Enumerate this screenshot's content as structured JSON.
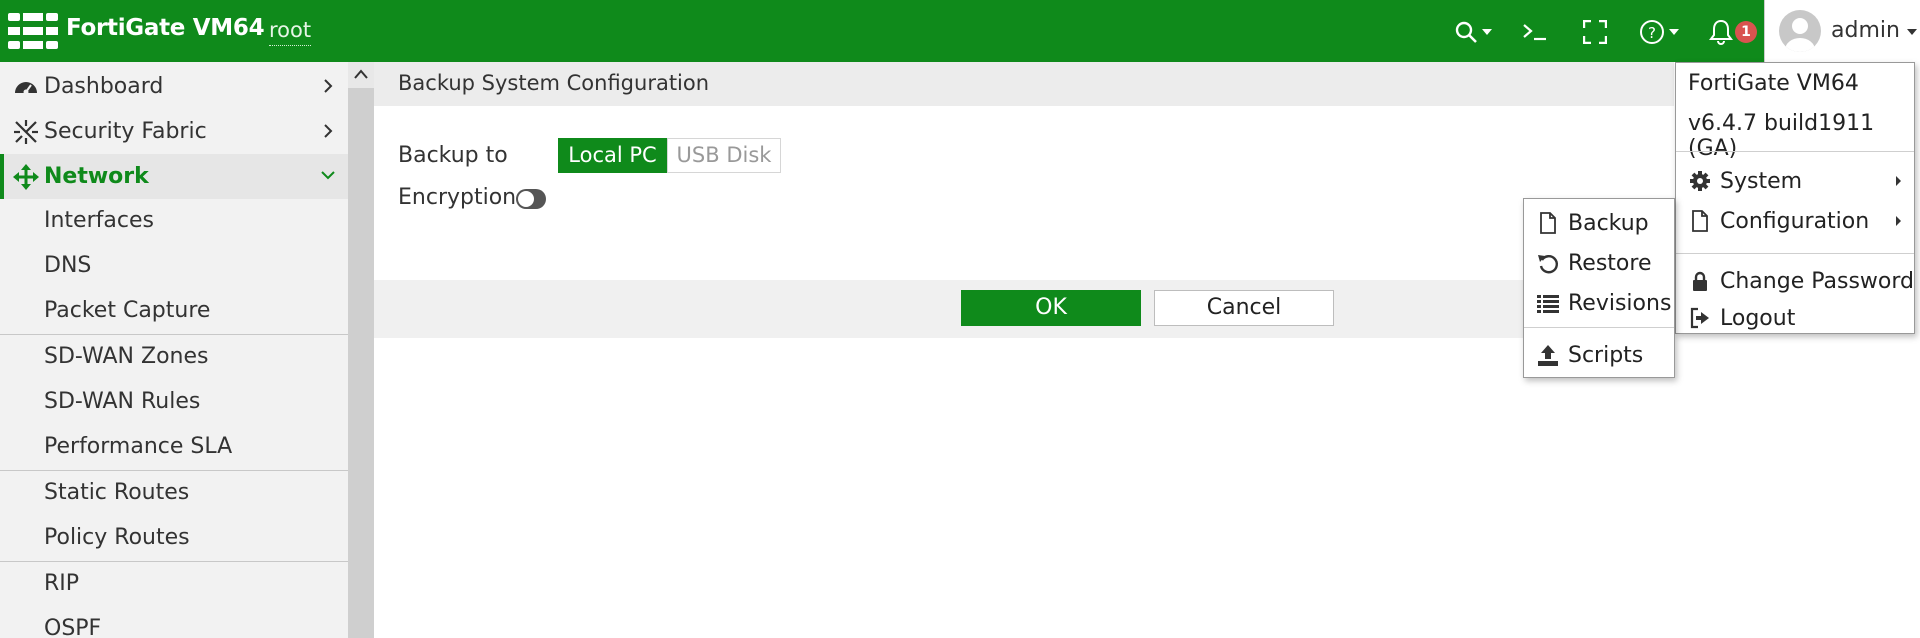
{
  "header": {
    "brand": "FortiGate VM64",
    "vdom": "root",
    "notification_count": "1",
    "user": "admin"
  },
  "sidebar": {
    "items": [
      {
        "label": "Dashboard",
        "icon": "dashboard-icon"
      },
      {
        "label": "Security Fabric",
        "icon": "security-fabric-icon"
      },
      {
        "label": "Network",
        "icon": "network-icon"
      }
    ],
    "subitems": [
      "Interfaces",
      "DNS",
      "Packet Capture",
      "SD-WAN Zones",
      "SD-WAN Rules",
      "Performance SLA",
      "Static Routes",
      "Policy Routes",
      "RIP",
      "OSPF"
    ]
  },
  "main": {
    "title": "Backup System Configuration",
    "backup_to_label": "Backup to",
    "backup_options": [
      "Local PC",
      "USB Disk"
    ],
    "encryption_label": "Encryption",
    "ok_label": "OK",
    "cancel_label": "Cancel"
  },
  "admin_menu": {
    "product": "FortiGate VM64",
    "version": "v6.4.7 build1911 (GA)",
    "items": [
      "System",
      "Configuration",
      "Change Password",
      "Logout"
    ]
  },
  "config_menu": {
    "items": [
      "Backup",
      "Restore",
      "Revisions",
      "Scripts"
    ]
  },
  "colors": {
    "accent": "#0f8a1b",
    "badge": "#d9534f"
  }
}
